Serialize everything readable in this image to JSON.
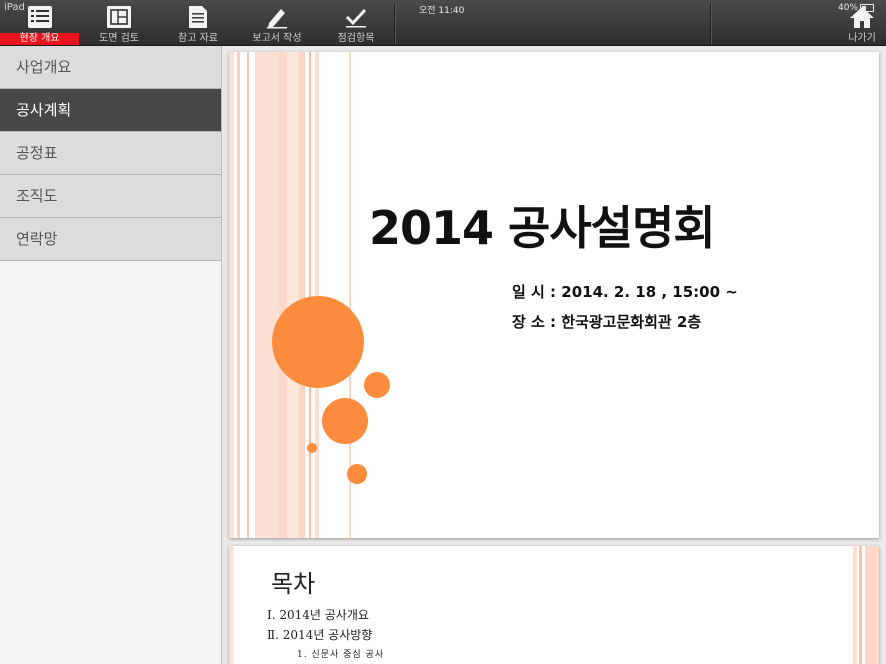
{
  "status": {
    "device": "iPad",
    "time": "오전 11:40",
    "battery": "40%"
  },
  "toolbar": {
    "items": [
      {
        "label": "현장 개요",
        "icon": "checklist-icon",
        "active": true
      },
      {
        "label": "도면 검토",
        "icon": "blueprint-icon",
        "active": false
      },
      {
        "label": "참고 자료",
        "icon": "document-icon",
        "active": false
      },
      {
        "label": "보고서 작성",
        "icon": "pencil-icon",
        "active": false
      },
      {
        "label": "점검항목",
        "icon": "checkmark-icon",
        "active": false
      }
    ],
    "exit": {
      "label": "나가기",
      "icon": "home-icon"
    }
  },
  "sidebar": {
    "items": [
      {
        "label": "사업개요",
        "active": false
      },
      {
        "label": "공사계획",
        "active": true
      },
      {
        "label": "공정표",
        "active": false
      },
      {
        "label": "조직도",
        "active": false
      },
      {
        "label": "연락망",
        "active": false
      }
    ]
  },
  "slide1": {
    "title": "2014 공사설명회",
    "date_line": "일 시 : 2014. 2. 18 , 15:00 ~",
    "place_line": "장 소 : 한국광고문화회관 2층"
  },
  "slide2": {
    "title": "목차",
    "lines": [
      "Ⅰ. 2014년 공사개요",
      "Ⅱ. 2014년 공사방향",
      "1. 신문사 중심 공사"
    ]
  },
  "colors": {
    "accent_red": "#e8141e",
    "orange": "#fb8c3d",
    "stripe_light": "#fde0d4"
  }
}
